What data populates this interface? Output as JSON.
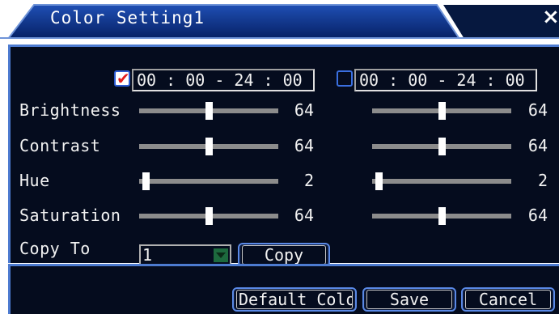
{
  "window": {
    "title": "Color Setting1",
    "close_label": "×"
  },
  "schedules": [
    {
      "enabled": true,
      "time": "00 : 00 - 24 : 00"
    },
    {
      "enabled": false,
      "time": "00 : 00 - 24 : 00"
    }
  ],
  "labels": {
    "brightness": "Brightness",
    "contrast": "Contrast",
    "hue": "Hue",
    "saturation": "Saturation",
    "copy_to": "Copy To"
  },
  "values": {
    "brightness": [
      "64",
      "64"
    ],
    "contrast": [
      "64",
      "64"
    ],
    "hue": [
      "2",
      "2"
    ],
    "saturation": [
      "64",
      "64"
    ]
  },
  "copy_to": {
    "selected": "1",
    "copy_label": "Copy"
  },
  "footer": {
    "default_label": "Default Colo",
    "save_label": "Save",
    "cancel_label": "Cancel"
  },
  "colors": {
    "panel": "#050c1e",
    "border": "#4d7bd0",
    "title_bar": "#0a2a7a",
    "check_red": "#e21d1d"
  },
  "icons": [
    "check-icon",
    "close-icon",
    "chevron-down-icon"
  ]
}
